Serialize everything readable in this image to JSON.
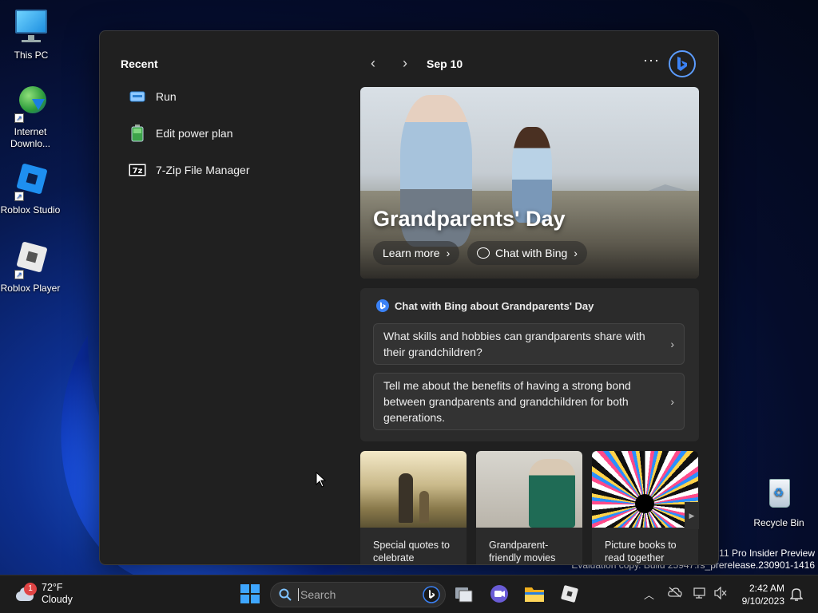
{
  "desktop": {
    "icons": [
      {
        "label": "This PC"
      },
      {
        "label": "Internet Downlo..."
      },
      {
        "label": "Roblox Studio"
      },
      {
        "label": "Roblox Player"
      },
      {
        "label": "Recycle Bin"
      }
    ],
    "watermark": {
      "line1": "s 11 Pro Insider Preview",
      "line2": "Evaluation copy. Build 25947.rs_prerelease.230901-1416"
    }
  },
  "panel": {
    "recent_title": "Recent",
    "recent_items": [
      {
        "label": "Run",
        "icon": "run-icon"
      },
      {
        "label": "Edit power plan",
        "icon": "battery-icon"
      },
      {
        "label": "7-Zip File Manager",
        "icon": "7zip-icon"
      }
    ],
    "nav": {
      "prev": "‹",
      "next": "›",
      "date": "Sep 10",
      "more": "···"
    },
    "hero": {
      "title": "Grandparents' Day",
      "learn_more": "Learn more",
      "chat_with_bing": "Chat with Bing"
    },
    "chat": {
      "header": "Chat with Bing about Grandparents' Day",
      "questions": [
        "What skills and hobbies can grandparents share with their grandchildren?",
        "Tell me about the benefits of having a strong bond between grandparents and grandchildren for both generations."
      ]
    },
    "thumbnails": [
      {
        "caption": "Special quotes to celebrate"
      },
      {
        "caption": "Grandparent-friendly movies"
      },
      {
        "caption": "Picture books to read together"
      }
    ]
  },
  "taskbar": {
    "weather": {
      "temp": "72°F",
      "condition": "Cloudy",
      "badge": "1"
    },
    "search_placeholder": "Search",
    "clock": {
      "time": "2:42 AM",
      "date": "9/10/2023"
    }
  },
  "colors": {
    "accent": "#3b82f6",
    "panel_bg": "#202020",
    "taskbar_bg": "#1c1c1c"
  }
}
